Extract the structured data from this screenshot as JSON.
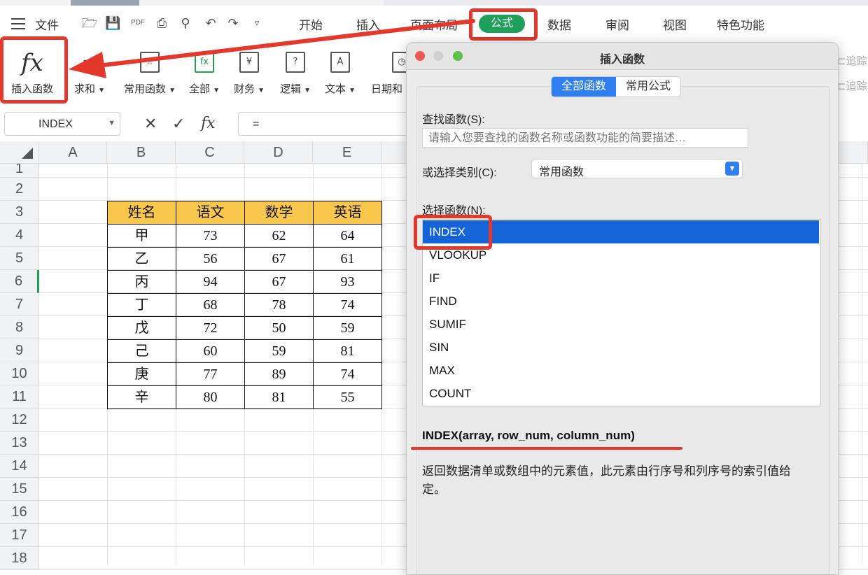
{
  "menu": {
    "file": "文件",
    "tabs": [
      "开始",
      "插入",
      "页面布局",
      "公式",
      "数据",
      "审阅",
      "视图",
      "特色功能"
    ],
    "active_tab": "公式"
  },
  "ribbon": {
    "insert_function": "插入函数",
    "sum": "求和",
    "common_functions": "常用函数",
    "all": "全部",
    "finance": "财务",
    "logic": "逻辑",
    "text": "文本",
    "datetime": "日期和",
    "trace1": "追踪",
    "trace2": "追踪",
    "fx_symbol": "fx"
  },
  "formula_bar": {
    "name_box": "INDEX",
    "cancel": "✕",
    "confirm": "✓",
    "fx": "fx",
    "content": "="
  },
  "sheet": {
    "columns": [
      "A",
      "B",
      "C",
      "D",
      "E"
    ],
    "rows": [
      "1",
      "2",
      "3",
      "4",
      "5",
      "6",
      "7",
      "8",
      "9",
      "10",
      "11",
      "12",
      "13",
      "14",
      "15",
      "16",
      "17",
      "18"
    ],
    "table_headers": [
      "姓名",
      "语文",
      "数学",
      "英语"
    ],
    "table_rows": [
      [
        "甲",
        "73",
        "62",
        "64"
      ],
      [
        "乙",
        "56",
        "67",
        "61"
      ],
      [
        "丙",
        "94",
        "67",
        "93"
      ],
      [
        "丁",
        "68",
        "78",
        "74"
      ],
      [
        "戊",
        "72",
        "50",
        "59"
      ],
      [
        "己",
        "60",
        "59",
        "81"
      ],
      [
        "庚",
        "77",
        "89",
        "74"
      ],
      [
        "辛",
        "80",
        "81",
        "55"
      ]
    ],
    "header_color": "#f8c74b"
  },
  "dialog": {
    "title": "插入函数",
    "tabs": [
      "全部函数",
      "常用公式"
    ],
    "search_label": "查找函数(S):",
    "search_placeholder": "请输入您要查找的函数名称或函数功能的简要描述…",
    "category_label": "或选择类别(C):",
    "category_value": "常用函数",
    "select_label": "选择函数(N):",
    "functions": [
      "INDEX",
      "VLOOKUP",
      "IF",
      "FIND",
      "SUMIF",
      "SIN",
      "MAX",
      "COUNT"
    ],
    "selected_function": "INDEX",
    "signature": "INDEX(array, row_num, column_num)",
    "description": "返回数据清单或数组中的元素值，此元素由行序号和列序号的索引值给定。"
  },
  "colors": {
    "accent_green": "#1ea05b",
    "highlight_red": "#e4382d",
    "select_blue": "#1464d8"
  }
}
